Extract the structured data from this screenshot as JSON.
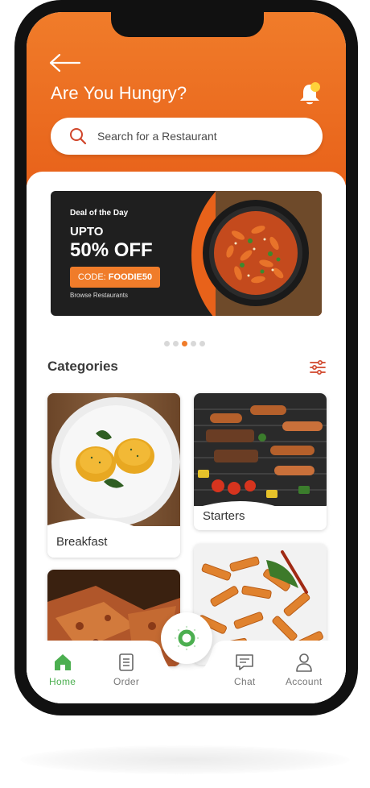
{
  "header": {
    "title": "Are You Hungry?",
    "back_icon": "arrow-left-icon",
    "notification_icon": "bell-icon",
    "accent_color": "#e8621a"
  },
  "search": {
    "placeholder": "Search for a Restaurant",
    "icon": "search-icon"
  },
  "banner": {
    "deal_label": "Deal of the Day",
    "upto": "UPTO",
    "discount": "50% OFF",
    "code_prefix": "CODE:",
    "code": "FOODIE50",
    "browse": "Browse Restaurants",
    "image": "pasta-pan-image"
  },
  "carousel": {
    "count": 5,
    "active_index": 2
  },
  "categories": {
    "title": "Categories",
    "filter_icon": "filter-sliders-icon",
    "items": [
      {
        "label": "Breakfast",
        "image": "eggs-benedict-image"
      },
      {
        "label": "Starters",
        "image": "grill-skewers-image"
      },
      {
        "label": "",
        "image": "pizza-image"
      },
      {
        "label": "",
        "image": "penne-pasta-image"
      }
    ]
  },
  "bottom_nav": {
    "items": [
      {
        "label": "Home",
        "icon": "home-icon",
        "active": true
      },
      {
        "label": "Order",
        "icon": "order-list-icon",
        "active": false
      },
      {
        "label": "Chat",
        "icon": "chat-icon",
        "active": false
      },
      {
        "label": "Account",
        "icon": "account-icon",
        "active": false
      }
    ],
    "center_button_icon": "ring-icon",
    "active_color": "#4caf50"
  }
}
